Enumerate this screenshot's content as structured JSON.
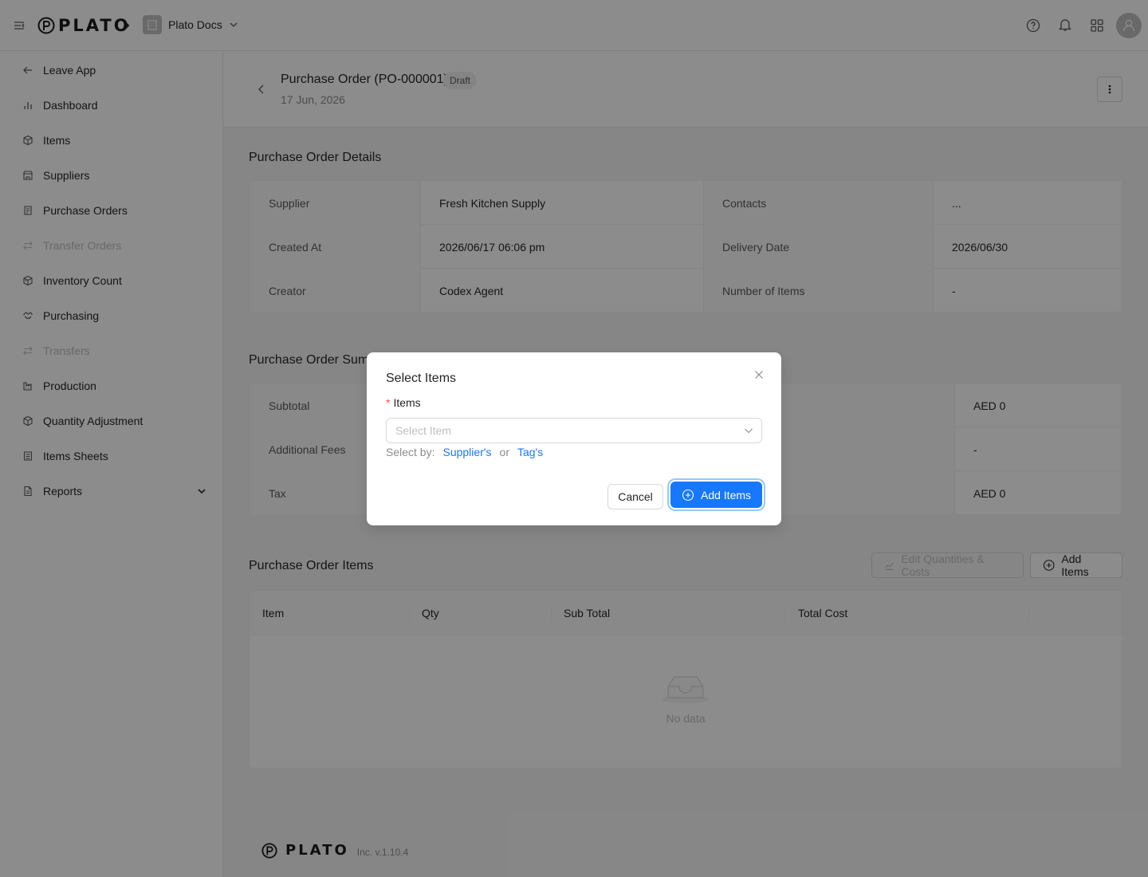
{
  "app": {
    "logo_text": "PLATO",
    "workspace_name": "Plato Docs"
  },
  "sidebar": {
    "items": [
      {
        "label": "Leave App",
        "icon": "arrow-left-icon",
        "disabled": false
      },
      {
        "label": "Dashboard",
        "icon": "bar-chart-icon",
        "disabled": false
      },
      {
        "label": "Items",
        "icon": "box-icon",
        "disabled": false
      },
      {
        "label": "Suppliers",
        "icon": "store-icon",
        "disabled": false
      },
      {
        "label": "Purchase Orders",
        "icon": "clipboard-icon",
        "disabled": false
      },
      {
        "label": "Transfer Orders",
        "icon": "swap-icon",
        "disabled": true
      },
      {
        "label": "Inventory Count",
        "icon": "boxes-icon",
        "disabled": false
      },
      {
        "label": "Purchasing",
        "icon": "handshake-icon",
        "disabled": false
      },
      {
        "label": "Transfers",
        "icon": "swap-icon",
        "disabled": true
      },
      {
        "label": "Production",
        "icon": "factory-icon",
        "disabled": false
      },
      {
        "label": "Quantity Adjustment",
        "icon": "box-adjust-icon",
        "disabled": false
      },
      {
        "label": "Items Sheets",
        "icon": "list-icon",
        "disabled": false
      },
      {
        "label": "Reports",
        "icon": "document-icon",
        "disabled": false
      }
    ]
  },
  "header": {
    "title": "Purchase Order (PO-000001)",
    "status": "Draft",
    "date": "17 Jun, 2026"
  },
  "details": {
    "title": "Purchase Order Details",
    "rows": [
      {
        "l1": "Supplier",
        "v1": "Fresh Kitchen Supply",
        "l2": "Contacts",
        "v2": "..."
      },
      {
        "l1": "Created At",
        "v1": "2026/06/17 06:06 pm",
        "l2": "Delivery Date",
        "v2": "2026/06/30"
      },
      {
        "l1": "Creator",
        "v1": "Codex Agent",
        "l2": "Number of Items",
        "v2": "-"
      }
    ]
  },
  "summary": {
    "title": "Purchase Order Summary",
    "rows": [
      {
        "label": "Subtotal",
        "value": "AED 0"
      },
      {
        "label": "Additional Fees",
        "value": "-"
      },
      {
        "label": "Tax",
        "value": "AED 0"
      }
    ]
  },
  "items_section": {
    "title": "Purchase Order Items",
    "edit_button": "Edit Quantities & Costs",
    "add_button": "Add Items",
    "columns": [
      "Item",
      "Qty",
      "Sub Total",
      "Total Cost"
    ],
    "empty_text": "No data"
  },
  "footer": {
    "logo_text": "PLATO",
    "version": "Inc. v.1.10.4"
  },
  "modal": {
    "title": "Select Items",
    "field_label": "Items",
    "required_mark": "*",
    "placeholder": "Select Item",
    "select_by_label": "Select by:",
    "select_by_supplier": "Supplier's",
    "select_by_or": "or",
    "select_by_tag": "Tag's",
    "cancel": "Cancel",
    "confirm": "Add Items"
  },
  "colors": {
    "primary": "#1677ff",
    "required": "#ff4d4f"
  }
}
